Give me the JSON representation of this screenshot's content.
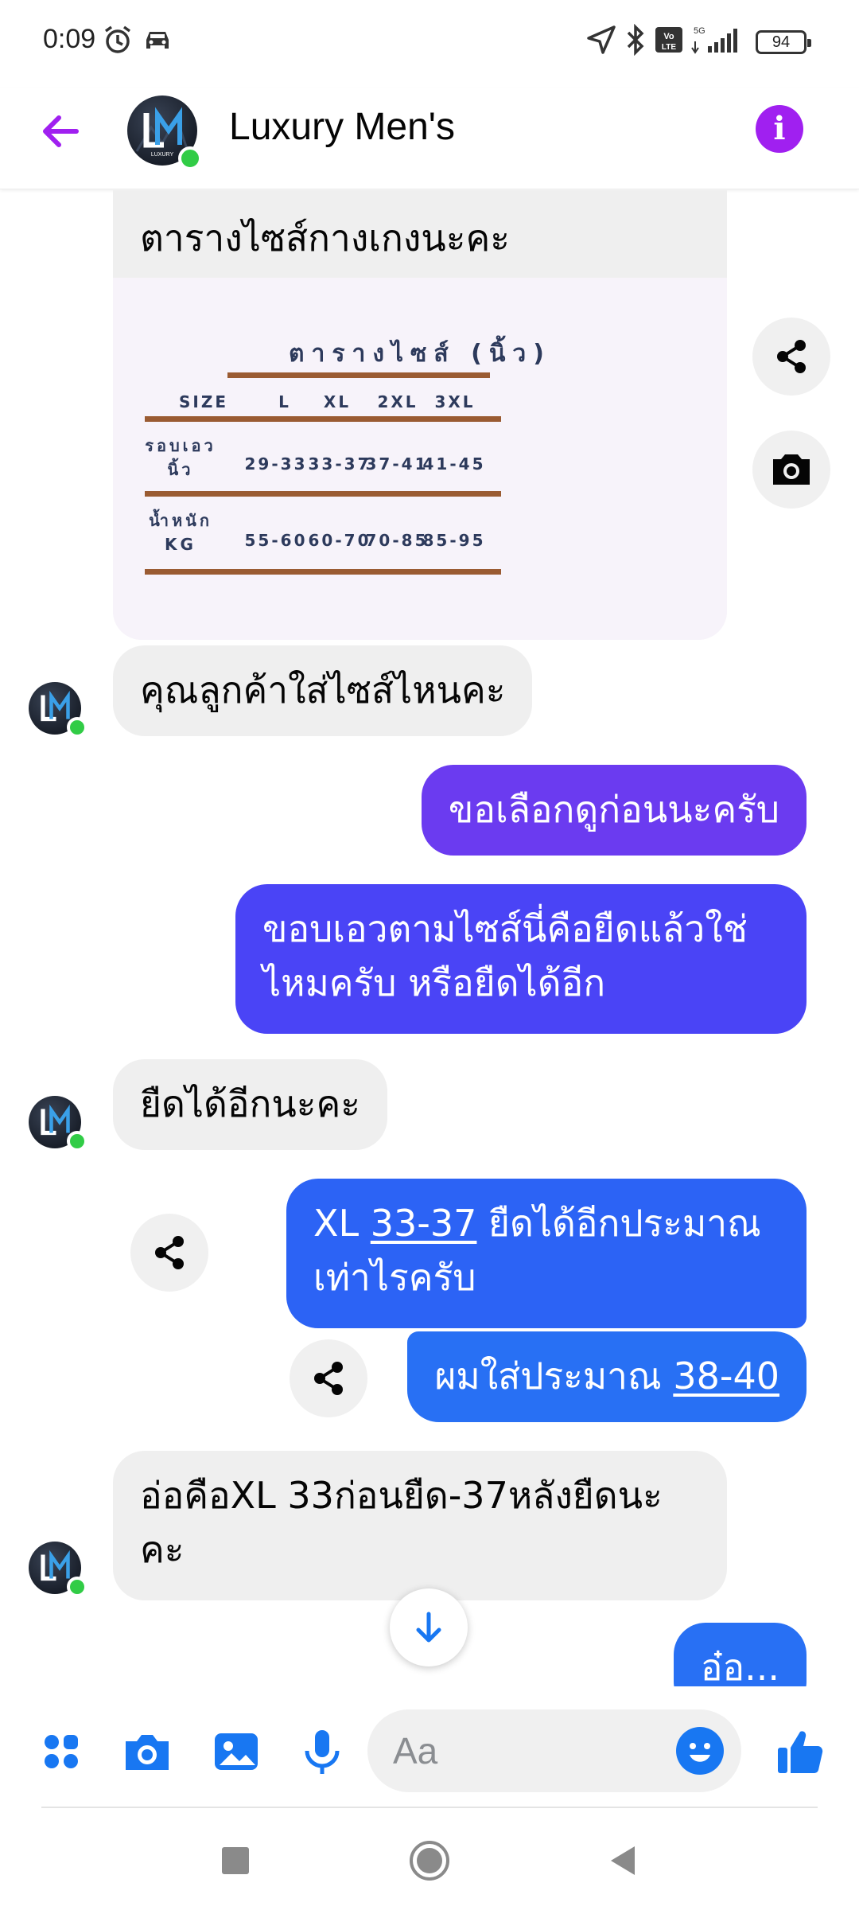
{
  "status_bar": {
    "time": "0:09",
    "battery": "94"
  },
  "header": {
    "title": "Luxury Men's",
    "avatar_text": "LUXURY"
  },
  "card": {
    "caption": "ตารางไซส์กางเกงนะคะ",
    "size_chart": {
      "title": "ตารางไซส์ (นิ้ว)",
      "size_label": "SIZE",
      "columns": [
        "L",
        "XL",
        "2XL",
        "3XL"
      ],
      "rows": [
        {
          "label_line1": "รอบเอว",
          "label_line2": "นิ้ว",
          "values": [
            "29-33",
            "33-37",
            "37-41",
            "41-45"
          ]
        },
        {
          "label_line1": "น้ำหนัก",
          "label_line2": "KG",
          "values": [
            "55-60",
            "60-70",
            "70-85",
            "85-95"
          ]
        }
      ]
    }
  },
  "messages": {
    "m1": "คุณลูกค้าใส่ไซส์ไหนคะ",
    "m2": "ขอเลือกดูก่อนนะครับ",
    "m3_line1": "ขอบเอวตามไซส์นี่คือยืดแล้วใช่",
    "m3_line2": "ไหมครับ หรือยืดได้อีก",
    "m4": "ยืดได้อีกนะคะ",
    "m5_prefix": "XL ",
    "m5_link": "33-37",
    "m5_suffix": " ยืดได้อีกประมาณ",
    "m5_line2": "เท่าไรครับ",
    "m6_prefix": "ผมใส่ประมาณ ",
    "m6_link": "38-40",
    "m7_line1": "อ่อคือXL 33ก่อนยืด-37หลังยืดนะ",
    "m7_line2": "คะ",
    "m8": "อ๋อ..."
  },
  "composer": {
    "placeholder": "Aa"
  },
  "colors": {
    "accent_purple": "#a020f0",
    "bubble_violet": "#6b3bf0",
    "bubble_indigo": "#4a44f6",
    "bubble_blue": "#2c63f5",
    "bubble_blue2": "#2870f4",
    "messenger_blue": "#1877f2",
    "online_green": "#31cc46"
  },
  "icons": {
    "back": "arrow-left-icon",
    "info": "info-icon",
    "share": "share-icon",
    "camera": "camera-icon",
    "apps": "apps-grid-icon",
    "gallery": "image-icon",
    "mic": "microphone-icon",
    "emoji": "emoji-icon",
    "like": "thumbs-up-icon",
    "scroll": "arrow-down-icon"
  }
}
